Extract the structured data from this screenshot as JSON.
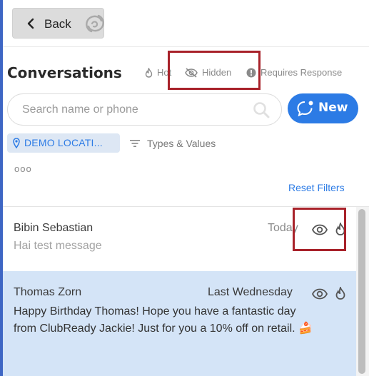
{
  "back_button": {
    "label": "Back"
  },
  "conversations": {
    "title": "Conversations",
    "filters": {
      "hot": "Hot",
      "hidden": "Hidden",
      "requires_response": "Requires Response"
    },
    "search": {
      "placeholder": "Search name or phone"
    },
    "new_button": {
      "label": "New"
    },
    "location_chip": {
      "label": "DEMO LOCATI..."
    },
    "types_filter": {
      "label": "Types & Values"
    },
    "more": "ooo",
    "reset_filters": "Reset Filters",
    "items": [
      {
        "name": "Bibin Sebastian",
        "date": "Today",
        "message": "Hai test message"
      },
      {
        "name": "Thomas Zorn",
        "date": "Last Wednesday",
        "message": "Happy Birthday Thomas! Hope you have a fantastic day from ClubReady Jackie! Just for you a 10% off on retail. 🍰"
      }
    ]
  },
  "colors": {
    "accent": "#2c7be5",
    "selected_row": "#d4e4f7",
    "annotation": "#a8222a"
  }
}
